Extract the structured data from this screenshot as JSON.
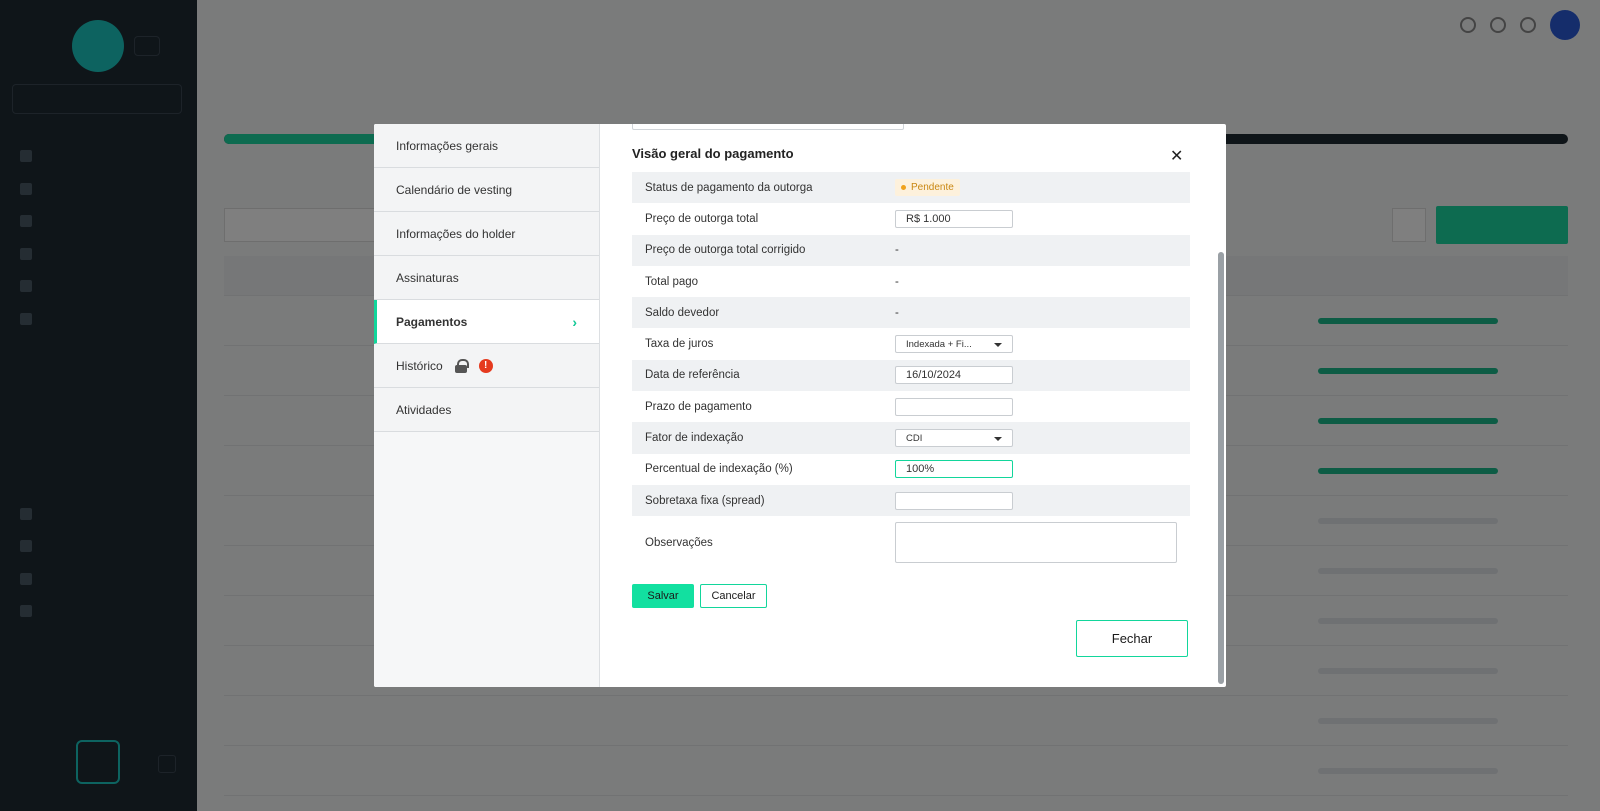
{
  "background": {
    "sidebar_select": "",
    "page_title": "",
    "page_subtitle": ""
  },
  "modal": {
    "nav": [
      {
        "label": "Informações gerais"
      },
      {
        "label": "Calendário de vesting"
      },
      {
        "label": "Informações do holder"
      },
      {
        "label": "Assinaturas"
      },
      {
        "label": "Pagamentos"
      },
      {
        "label": "Histórico"
      },
      {
        "label": "Atividades"
      }
    ],
    "active_nav": "Pagamentos",
    "historico_alert": "!",
    "section_title": "Visão geral do pagamento",
    "rows": {
      "status": {
        "label": "Status de pagamento da outorga",
        "badge": "Pendente"
      },
      "preco_total": {
        "label": "Preço de outorga total",
        "value": "R$ 1.000"
      },
      "preco_corrigido": {
        "label": "Preço de outorga total corrigido",
        "value": "-"
      },
      "total_pago": {
        "label": "Total pago",
        "value": "-"
      },
      "saldo": {
        "label": "Saldo devedor",
        "value": "-"
      },
      "taxa": {
        "label": "Taxa de juros",
        "value": "Indexada + Fi..."
      },
      "data_ref": {
        "label": "Data de referência",
        "value": "16/10/2024"
      },
      "prazo": {
        "label": "Prazo de pagamento",
        "value": ""
      },
      "fator": {
        "label": "Fator de indexação",
        "value": "CDI"
      },
      "percentual": {
        "label": "Percentual de indexação (%)",
        "value": "100%"
      },
      "sobretaxa": {
        "label": "Sobretaxa fixa (spread)",
        "value": ""
      },
      "observacoes": {
        "label": "Observações",
        "value": ""
      }
    },
    "buttons": {
      "salvar": "Salvar",
      "cancelar": "Cancelar",
      "fechar": "Fechar"
    },
    "colors": {
      "accent": "#12d69b",
      "pending": "#f0a21b",
      "alert": "#e53a1e"
    }
  }
}
